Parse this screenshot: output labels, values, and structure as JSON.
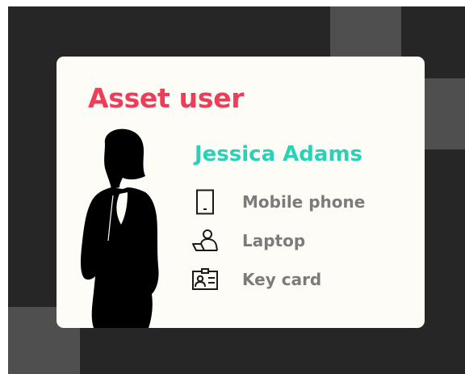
{
  "card": {
    "title": "Asset user",
    "user_name": "Jessica Adams",
    "assets": [
      {
        "label": "Mobile phone",
        "icon": "mobile-phone-icon"
      },
      {
        "label": "Laptop",
        "icon": "laptop-user-icon"
      },
      {
        "label": "Key card",
        "icon": "key-card-icon"
      }
    ]
  },
  "colors": {
    "background": "#262626",
    "tile": "#4f4f4f",
    "card": "#fdfcf7",
    "title": "#ee3d58",
    "name": "#2bd1b7",
    "asset_text": "#7b7b7b"
  }
}
